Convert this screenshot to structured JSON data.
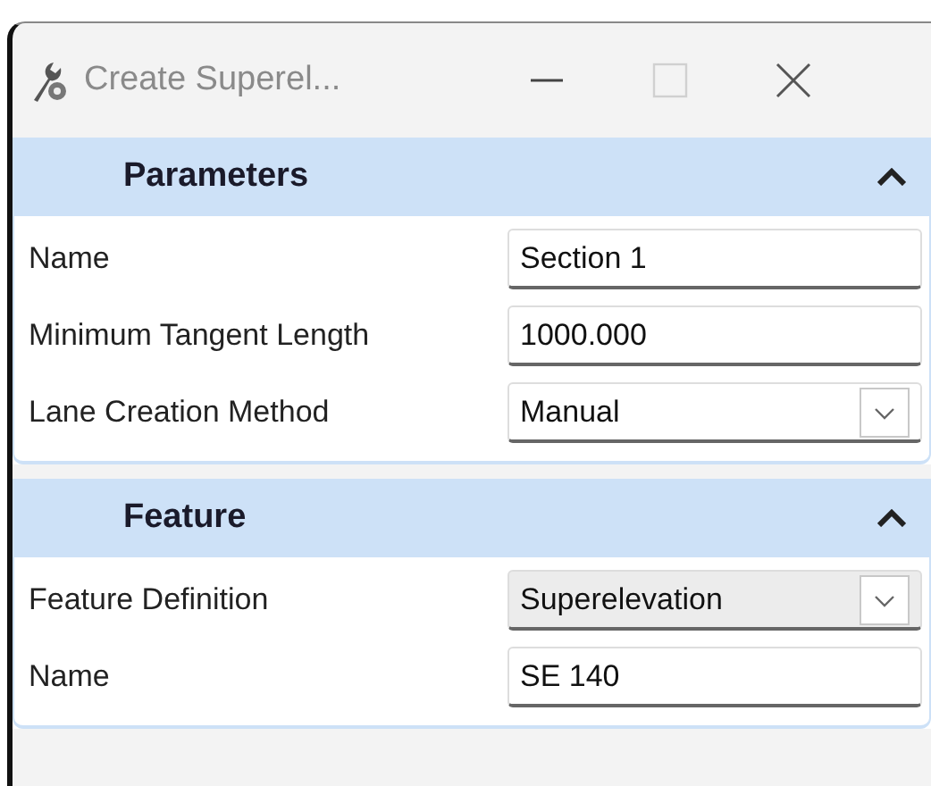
{
  "window": {
    "title": "Create Superel..."
  },
  "sections": [
    {
      "title": "Parameters",
      "expanded": true,
      "fields": [
        {
          "label": "Name",
          "kind": "text",
          "value": "Section 1"
        },
        {
          "label": "Minimum Tangent Length",
          "kind": "text",
          "value": "1000.000"
        },
        {
          "label": "Lane Creation Method",
          "kind": "dropdown",
          "value": "Manual",
          "disabled": false
        }
      ]
    },
    {
      "title": "Feature",
      "expanded": true,
      "fields": [
        {
          "label": "Feature Definition",
          "kind": "dropdown",
          "value": "Superelevation",
          "disabled": true
        },
        {
          "label": "Name",
          "kind": "text",
          "value": "SE 140"
        }
      ]
    }
  ]
}
